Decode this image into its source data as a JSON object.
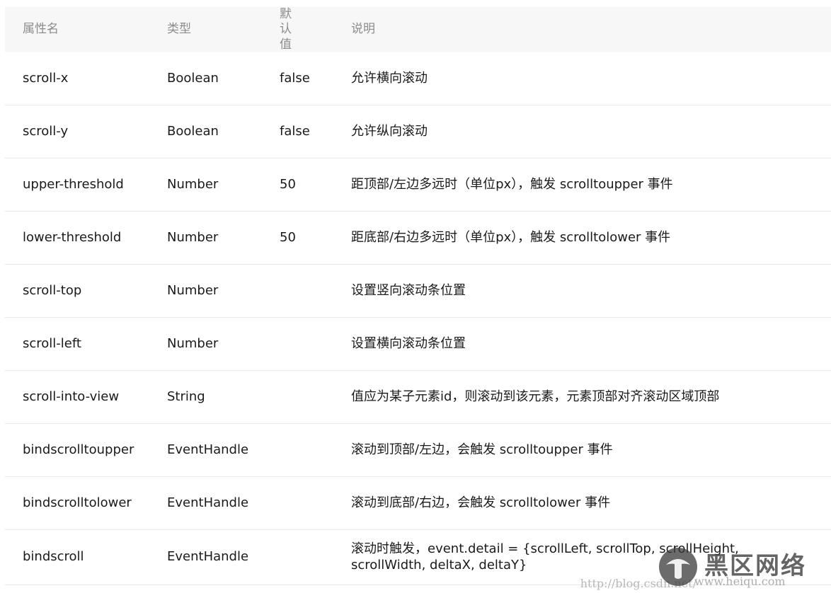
{
  "table": {
    "headers": [
      "属性名",
      "类型",
      "默认值",
      "说明"
    ],
    "rows": [
      {
        "name": "scroll-x",
        "type": "Boolean",
        "default": "false",
        "desc": "允许横向滚动"
      },
      {
        "name": "scroll-y",
        "type": "Boolean",
        "default": "false",
        "desc": "允许纵向滚动"
      },
      {
        "name": "upper-threshold",
        "type": "Number",
        "default": "50",
        "desc": "距顶部/左边多远时（单位px），触发 scrolltoupper 事件"
      },
      {
        "name": "lower-threshold",
        "type": "Number",
        "default": "50",
        "desc": "距底部/右边多远时（单位px），触发 scrolltolower 事件"
      },
      {
        "name": "scroll-top",
        "type": "Number",
        "default": "",
        "desc": "设置竖向滚动条位置"
      },
      {
        "name": "scroll-left",
        "type": "Number",
        "default": "",
        "desc": "设置横向滚动条位置"
      },
      {
        "name": "scroll-into-view",
        "type": "String",
        "default": "",
        "desc": "值应为某子元素id，则滚动到该元素，元素顶部对齐滚动区域顶部"
      },
      {
        "name": "bindscrolltoupper",
        "type": "EventHandle",
        "default": "",
        "desc": "滚动到顶部/左边，会触发 scrolltoupper 事件"
      },
      {
        "name": "bindscrolltolower",
        "type": "EventHandle",
        "default": "",
        "desc": "滚动到底部/右边，会触发 scrolltolower 事件"
      },
      {
        "name": "bindscroll",
        "type": "EventHandle",
        "default": "",
        "desc": "滚动时触发，event.detail = {scrollLeft, scrollTop, scrollHeight, scrollWidth, deltaX, deltaY}"
      }
    ]
  },
  "watermark": {
    "brand": "黑区网络",
    "url": "www.heiqu.com",
    "blog_prefix": "http://blog.csdn.net/"
  }
}
